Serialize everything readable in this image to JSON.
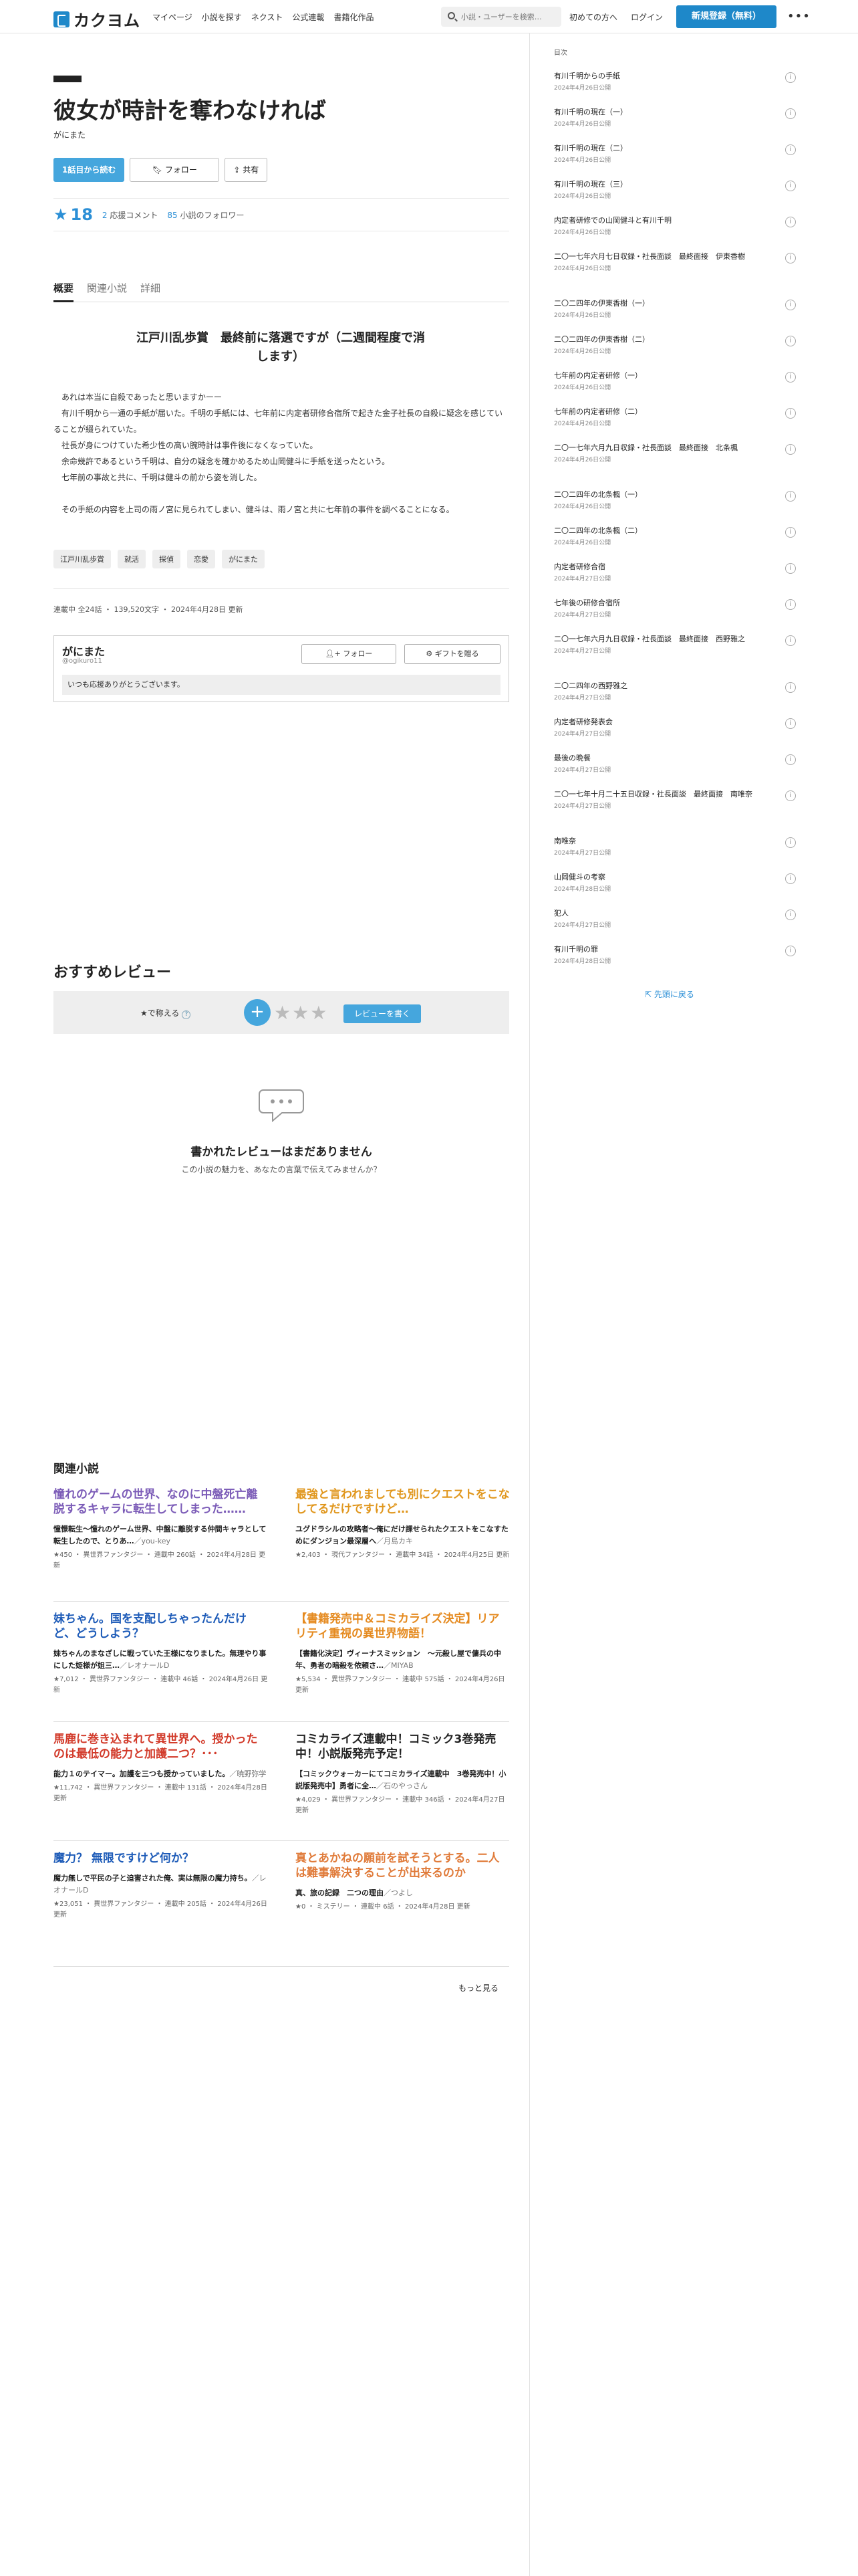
{
  "header": {
    "logo_text": "カクヨム",
    "nav": [
      "マイページ",
      "小説を探す",
      "ネクスト",
      "公式連載",
      "書籍化作品"
    ],
    "search_placeholder": "小説・ユーザーを検索…",
    "first_time": "初めての方へ",
    "login": "ログイン",
    "register": "新規登録（無料）",
    "more": "•••"
  },
  "work": {
    "title": "彼女が時計を奪わなければ",
    "author": "がにまた",
    "read_button": "1話目から読む",
    "follow_button": "フォロー",
    "share_button": "共有",
    "rating": "18",
    "comments_count": "2",
    "comments_label": "応援コメント",
    "followers_count": "85",
    "followers_label": "小説のフォロワー"
  },
  "tabs": [
    "概要",
    "関連小説",
    "詳細"
  ],
  "catchphrase": "江戸川乱歩賞　最終前に落選ですが（二週間程度で消します）",
  "intro": [
    "　あれは本当に自殺であったと思いますかーー",
    "　有川千明から一通の手紙が届いた。千明の手紙には、七年前に内定者研修合宿所で起きた金子社長の自殺に疑念を感じていることが綴られていた。",
    "　社長が身につけていた希少性の高い腕時計は事件後になくなっていた。",
    "　余命幾許であるという千明は、自分の疑念を確かめるため山岡健斗に手紙を送ったという。",
    "　七年前の事故と共に、千明は健斗の前から姿を消した。",
    "",
    "　その手紙の内容を上司の雨ノ宮に見られてしまい、健斗は、雨ノ宮と共に七年前の事件を調べることになる。"
  ],
  "tags": [
    "江戸川乱歩賞",
    "就活",
    "探偵",
    "恋愛",
    "がにまた"
  ],
  "meta": "連載中 全24話 ・ 139,520文字 ・ 2024年4月28日 更新",
  "author_box": {
    "name": "がにまた",
    "id": "@ogikuro11",
    "follow": "フォロー",
    "gift": "ギフトを贈る",
    "message": "いつも応援ありがとうございます。"
  },
  "reviews": {
    "heading": "おすすめレビュー",
    "rate_label": "★で称える",
    "plus": "+",
    "stars": "★★★",
    "write_button": "レビューを書く",
    "empty_title": "書かれたレビューはまだありません",
    "empty_sub": "この小説の魅力を、あなたの言葉で伝えてみませんか？"
  },
  "related": {
    "heading": "関連小説",
    "items": [
      {
        "title": "憧れのゲームの世界、なのに中盤死亡離脱するキャラに転生してしまった……",
        "color": "#7b5bb7",
        "desc": "憧憬転生〜憧れのゲーム世界、中盤に離脱する仲間キャラとして転生したので、とりあ…",
        "author": "／you-key",
        "meta": "★450 ・ 異世界ファンタジー ・ 連載中 260話 ・ 2024年4月28日 更新"
      },
      {
        "title": "最強と言われましても別にクエストをこなしてるだけですけど…",
        "color": "#e0961c",
        "desc": "ユグドラシルの攻略者〜俺にだけ課せられたクエストをこなすためにダンジョン最深層へ",
        "author": "／月島カキ",
        "meta": "★2,403 ・ 現代ファンタジー ・ 連載中 34話 ・ 2024年4月25日 更新"
      },
      {
        "title": "妹ちゃん。国を支配しちゃったんだけど、どうしよう？",
        "color": "#1d5bb8",
        "desc": "妹ちゃんのまなざしに戦っていた王様になりました。無理やり事にした姫様が姐三…",
        "author": "／レオナールD",
        "meta": "★7,012 ・ 異世界ファンタジー ・ 連載中 46話 ・ 2024年4月26日 更新"
      },
      {
        "title": "【書籍発売中＆コミカライズ決定】リアリティ重視の異世界物語！",
        "color": "#e58a1f",
        "desc": "【書籍化決定】ヴィーナスミッション　〜元殺し屋で傭兵の中年、勇者の暗殺を依頼さ…",
        "author": "／MIYAB",
        "meta": "★5,534 ・ 異世界ファンタジー ・ 連載中 575話 ・ 2024年4月26日 更新"
      },
      {
        "title": "馬鹿に巻き込まれて異世界へ。授かったのは最低の能力と加護二つ？･･･",
        "color": "#d23a2a",
        "desc": "能力１のテイマー。加護を三つも授かっていました。",
        "author": "／暁野弥学",
        "meta": "★11,742 ・ 異世界ファンタジー ・ 連載中 131話 ・ 2024年4月28日 更新"
      },
      {
        "title": "コミカライズ連載中！コミック3巻発売中！小説版発売予定！",
        "color": "#222222",
        "desc": "【コミックウォーカーにてコミカライズ連載中　3巻発売中！小説版発売中】勇者に全…",
        "author": "／石のやっさん",
        "meta": "★4,029 ・ 異世界ファンタジー ・ 連載中 346話 ・ 2024年4月27日 更新"
      },
      {
        "title": "魔力？ 無限ですけど何か？",
        "color": "#1d5bb8",
        "desc": "魔力無しで平民の子と迫害された俺、実は無限の魔力持ち。",
        "author": "／レオナールD",
        "meta": "★23,051 ・ 異世界ファンタジー ・ 連載中 205話 ・ 2024年4月26日 更新"
      },
      {
        "title": "真とあかねの願前を試そうとする。二人は難事解決することが出来るのか",
        "color": "#e07b3a",
        "desc": "真、旅の記録　二つの理由",
        "author": "／つよし",
        "meta": "★0 ・ ミステリー ・ 連載中 6話 ・ 2024年4月28日 更新"
      }
    ],
    "more": "もっと見る"
  },
  "toc": {
    "heading": "目次",
    "items": [
      {
        "title": "有川千明からの手紙",
        "date": "2024年4月26日公開"
      },
      {
        "title": "有川千明の現在（一）",
        "date": "2024年4月26日公開"
      },
      {
        "title": "有川千明の現在（二）",
        "date": "2024年4月26日公開"
      },
      {
        "title": "有川千明の現在（三）",
        "date": "2024年4月26日公開"
      },
      {
        "title": "内定者研修での山岡健斗と有川千明",
        "date": "2024年4月26日公開"
      },
      {
        "title": "二〇一七年六月七日収録・社長面談　最終面接　伊東香樹",
        "date": "2024年4月26日公開"
      },
      {
        "title": "二〇二四年の伊東香樹（一）",
        "date": "2024年4月26日公開"
      },
      {
        "title": "二〇二四年の伊東香樹（二）",
        "date": "2024年4月26日公開"
      },
      {
        "title": "七年前の内定者研修（一）",
        "date": "2024年4月26日公開"
      },
      {
        "title": "七年前の内定者研修（二）",
        "date": "2024年4月26日公開"
      },
      {
        "title": "二〇一七年六月九日収録・社長面談　最終面接　北条楓",
        "date": "2024年4月26日公開"
      },
      {
        "title": "二〇二四年の北条楓（一）",
        "date": "2024年4月26日公開"
      },
      {
        "title": "二〇二四年の北条楓（二）",
        "date": "2024年4月26日公開"
      },
      {
        "title": "内定者研修合宿",
        "date": "2024年4月27日公開"
      },
      {
        "title": "七年後の研修合宿所",
        "date": "2024年4月27日公開"
      },
      {
        "title": "二〇一七年六月九日収録・社長面談　最終面接　西野雅之",
        "date": "2024年4月27日公開"
      },
      {
        "title": "二〇二四年の西野雅之",
        "date": "2024年4月27日公開"
      },
      {
        "title": "内定者研修発表会",
        "date": "2024年4月27日公開"
      },
      {
        "title": "最後の晩餐",
        "date": "2024年4月27日公開"
      },
      {
        "title": "二〇一七年十月二十五日収録・社長面談　最終面接　南唯奈",
        "date": "2024年4月27日公開"
      },
      {
        "title": "南唯奈",
        "date": "2024年4月27日公開"
      },
      {
        "title": "山岡健斗の考察",
        "date": "2024年4月28日公開"
      },
      {
        "title": "犯人",
        "date": "2024年4月27日公開"
      },
      {
        "title": "有川千明の罪",
        "date": "2024年4月28日公開"
      }
    ],
    "back_to_top": "先頭に戻る"
  }
}
